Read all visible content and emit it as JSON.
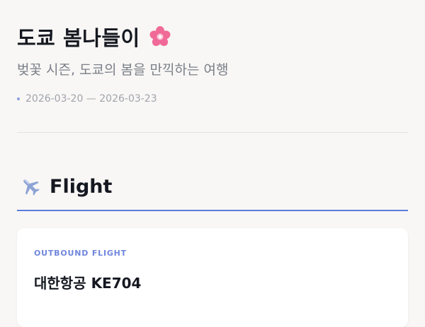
{
  "trip": {
    "title": "도쿄 봄나들이",
    "title_icon": "cherry-blossom-icon",
    "subtitle": "벚꽃 시즌, 도쿄의 봄을 만끽하는 여행",
    "date_range": "2026-03-20 — 2026-03-23"
  },
  "section": {
    "icon": "airplane-icon",
    "title": "Flight"
  },
  "flight_card": {
    "label": "OUTBOUND FLIGHT",
    "airline": "대한항공 KE704"
  },
  "colors": {
    "accent": "#5b7ce0",
    "background": "#f8f7f5",
    "blossom": "#f06a98"
  }
}
